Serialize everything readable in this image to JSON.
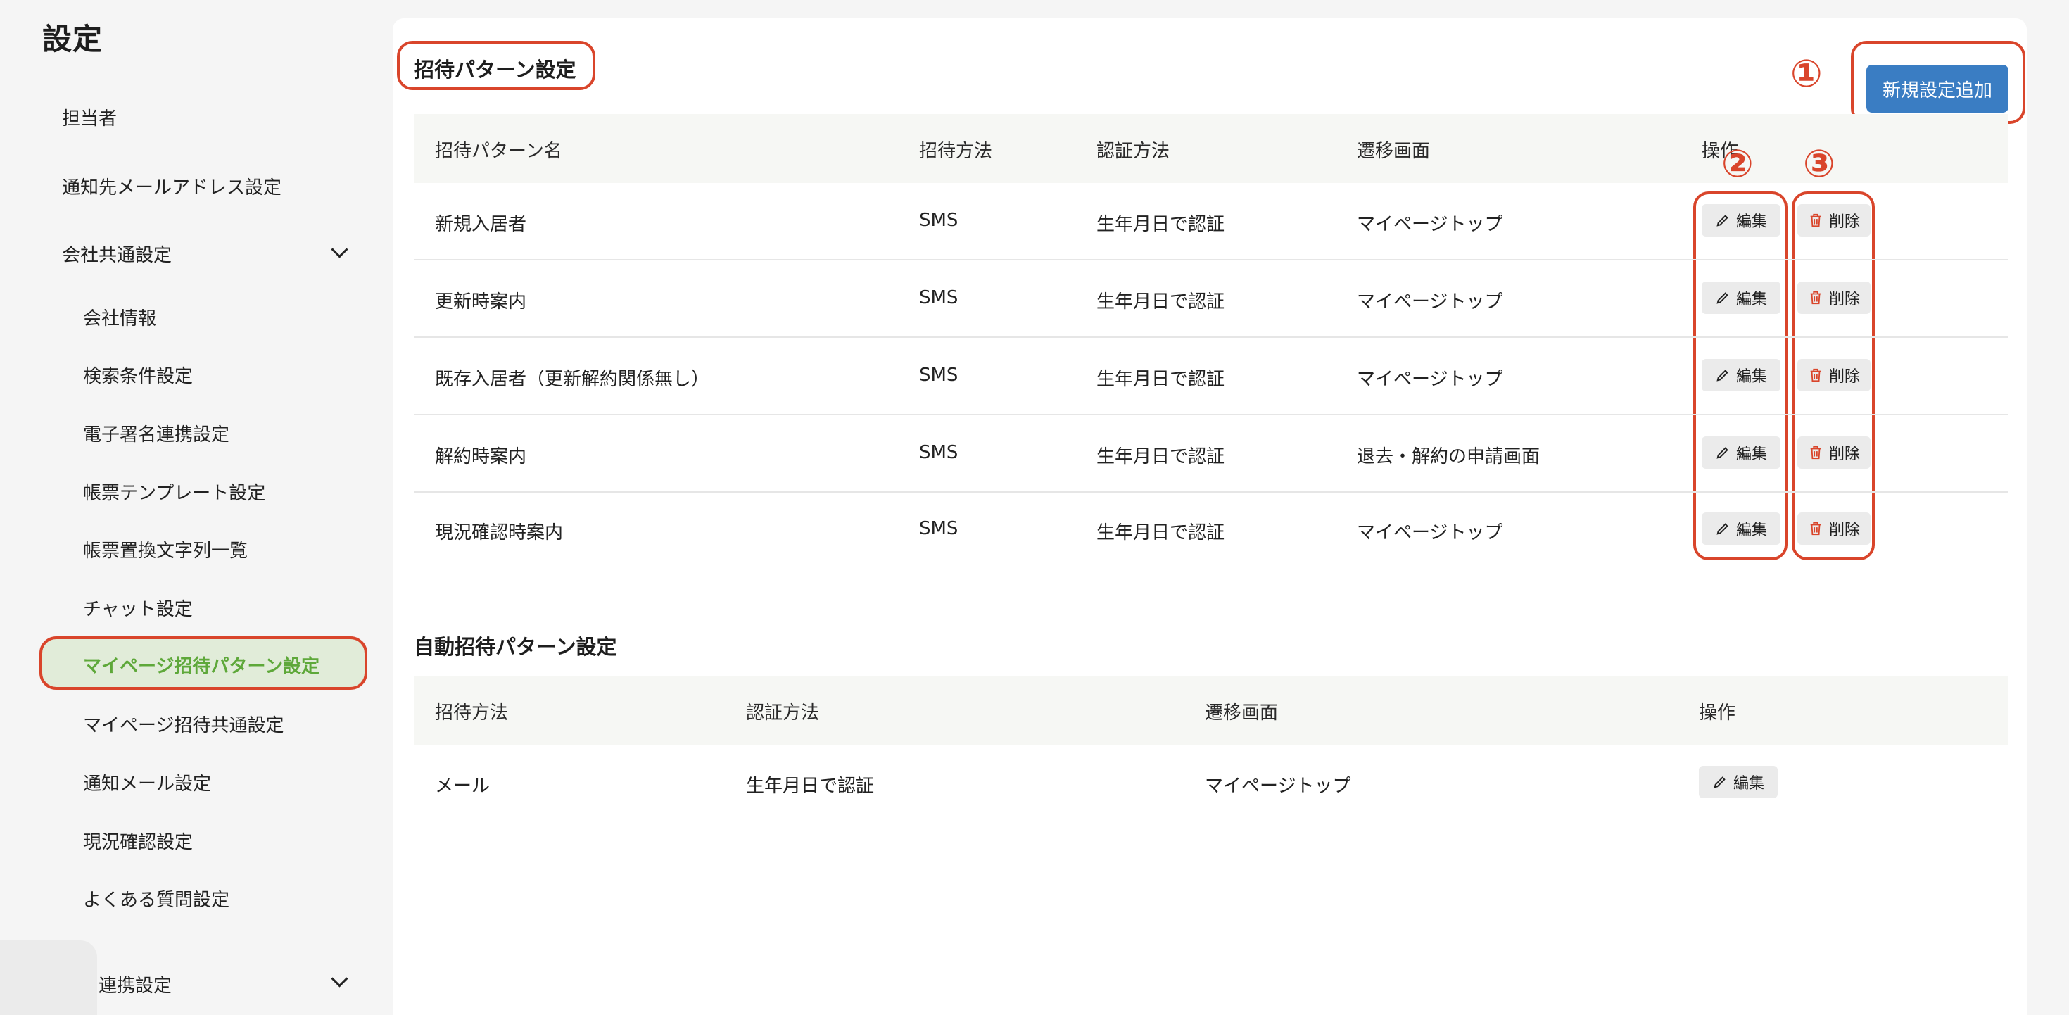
{
  "sidebar": {
    "title": "設定",
    "items": [
      {
        "label": "担当者"
      },
      {
        "label": "通知先メールアドレス設定"
      },
      {
        "label": "会社共通設定"
      },
      {
        "label": "会社情報"
      },
      {
        "label": "検索条件設定"
      },
      {
        "label": "電子署名連携設定"
      },
      {
        "label": "帳票テンプレート設定"
      },
      {
        "label": "帳票置換文字列一覧"
      },
      {
        "label": "チャット設定"
      },
      {
        "label": "マイページ招待パターン設定"
      },
      {
        "label": "マイページ招待共通設定"
      },
      {
        "label": "通知メール設定"
      },
      {
        "label": "現況確認設定"
      },
      {
        "label": "よくある質問設定"
      },
      {
        "label": "連携設定"
      }
    ]
  },
  "invite_patterns": {
    "title": "招待パターン設定",
    "add_button": "新規設定追加",
    "headers": [
      "招待パターン名",
      "招待方法",
      "認証方法",
      "遷移画面",
      "操作"
    ],
    "rows": [
      {
        "name": "新規入居者",
        "method": "SMS",
        "auth": "生年月日で認証",
        "screen": "マイページトップ"
      },
      {
        "name": "更新時案内",
        "method": "SMS",
        "auth": "生年月日で認証",
        "screen": "マイページトップ"
      },
      {
        "name": "既存入居者（更新解約関係無し）",
        "method": "SMS",
        "auth": "生年月日で認証",
        "screen": "マイページトップ"
      },
      {
        "name": "解約時案内",
        "method": "SMS",
        "auth": "生年月日で認証",
        "screen": "退去・解約の申請画面"
      },
      {
        "name": "現況確認時案内",
        "method": "SMS",
        "auth": "生年月日で認証",
        "screen": "マイページトップ"
      }
    ],
    "edit_label": "編集",
    "delete_label": "削除"
  },
  "auto_invite": {
    "title": "自動招待パターン設定",
    "headers": [
      "招待方法",
      "認証方法",
      "遷移画面",
      "操作"
    ],
    "rows": [
      {
        "method": "メール",
        "auth": "生年月日で認証",
        "screen": "マイページトップ"
      }
    ],
    "edit_label": "編集"
  },
  "annotations": [
    "①",
    "②",
    "③"
  ],
  "colors": {
    "accent_red": "#d9452b",
    "primary_blue": "#3a7dc3",
    "active_green": "#5ea83a",
    "active_bg": "#e1ecd9"
  },
  "icons": [
    "pencil-icon",
    "trash-icon",
    "chevron-down-icon"
  ]
}
